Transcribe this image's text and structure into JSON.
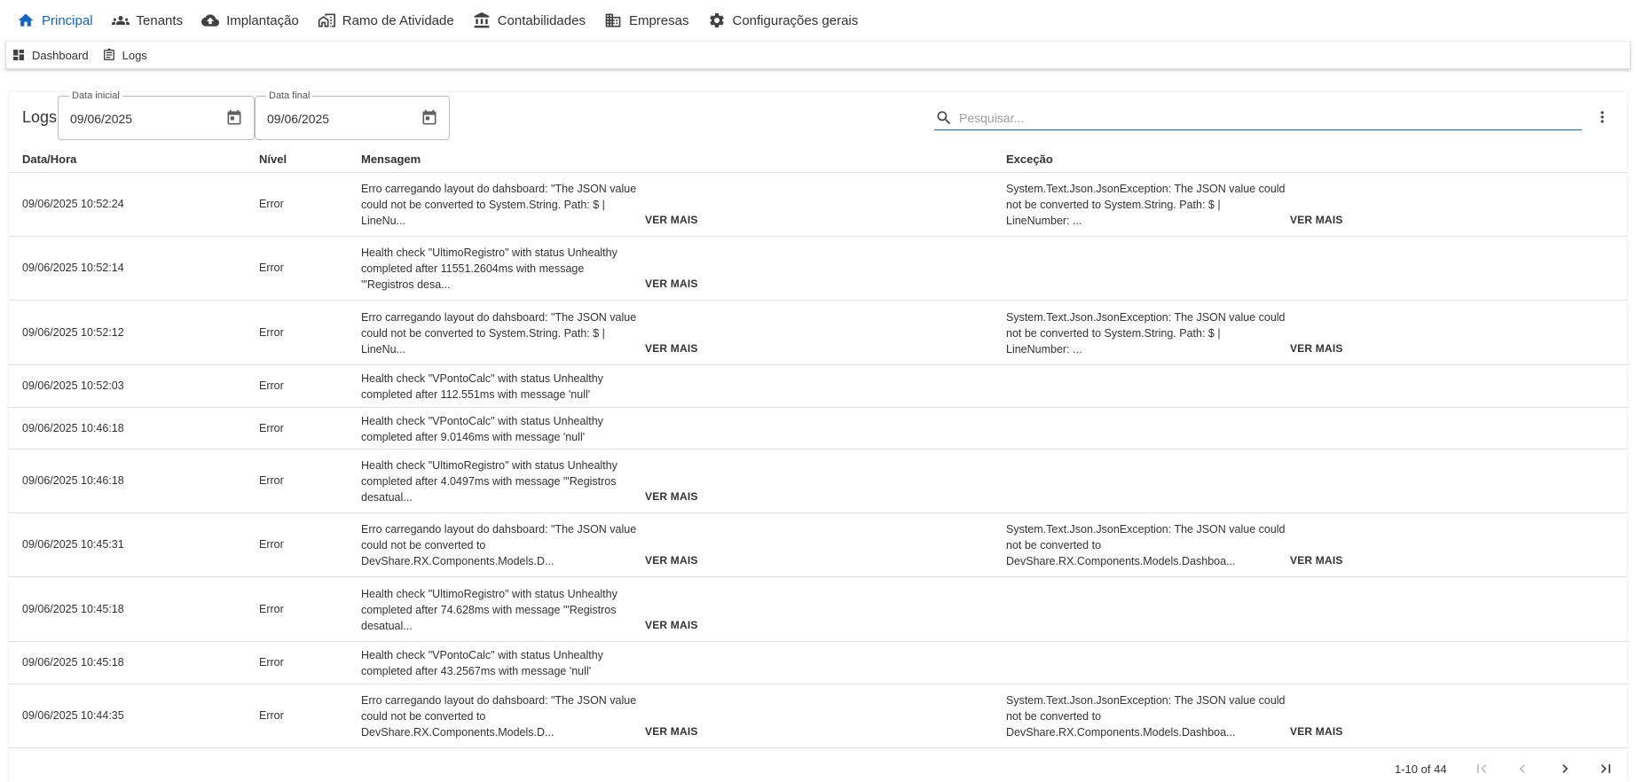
{
  "topnav": {
    "items": [
      {
        "label": "Principal",
        "icon": "home-icon",
        "active": true
      },
      {
        "label": "Tenants",
        "icon": "groups-icon"
      },
      {
        "label": "Implantação",
        "icon": "cloud-upload-icon"
      },
      {
        "label": "Ramo de Atividade",
        "icon": "store-icon"
      },
      {
        "label": "Contabilidades",
        "icon": "bank-icon"
      },
      {
        "label": "Empresas",
        "icon": "building-icon"
      },
      {
        "label": "Configurações gerais",
        "icon": "gear-icon"
      }
    ]
  },
  "subnav": {
    "items": [
      {
        "label": "Dashboard",
        "icon": "dashboard-icon"
      },
      {
        "label": "Logs",
        "icon": "list-icon"
      }
    ]
  },
  "page": {
    "title": "Logs",
    "date_start": {
      "label": "Data inicial",
      "value": "09/06/2025"
    },
    "date_end": {
      "label": "Data final",
      "value": "09/06/2025"
    },
    "search_placeholder": "Pesquisar..."
  },
  "table": {
    "headers": {
      "date": "Data/Hora",
      "level": "Nível",
      "message": "Mensagem",
      "exception": "Exceção"
    },
    "more_label": "VER MAIS",
    "rows": [
      {
        "date": "09/06/2025 10:52:24",
        "level": "Error",
        "message": [
          "Erro carregando layout do dahsboard: \"The JSON value",
          "could not be converted to System.String. Path: $ |",
          "LineNu..."
        ],
        "message_more": true,
        "exception": [
          "System.Text.Json.JsonException: The JSON value could",
          "not be converted to System.String. Path: $ |",
          "LineNumber: ..."
        ],
        "exception_more": true
      },
      {
        "date": "09/06/2025 10:52:14",
        "level": "Error",
        "message": [
          "Health check \"UltimoRegistro\" with status Unhealthy",
          "completed after 11551.2604ms with message",
          "'\"Registros desa..."
        ],
        "message_more": true,
        "exception": [],
        "exception_more": false
      },
      {
        "date": "09/06/2025 10:52:12",
        "level": "Error",
        "message": [
          "Erro carregando layout do dahsboard: \"The JSON value",
          "could not be converted to System.String. Path: $ |",
          "LineNu..."
        ],
        "message_more": true,
        "exception": [
          "System.Text.Json.JsonException: The JSON value could",
          "not be converted to System.String. Path: $ |",
          "LineNumber: ..."
        ],
        "exception_more": true
      },
      {
        "date": "09/06/2025 10:52:03",
        "level": "Error",
        "message": [
          "Health check \"VPontoCalc\" with status Unhealthy",
          "completed after 112.551ms with message 'null'"
        ],
        "message_more": false,
        "exception": [],
        "exception_more": false
      },
      {
        "date": "09/06/2025 10:46:18",
        "level": "Error",
        "message": [
          "Health check \"VPontoCalc\" with status Unhealthy",
          "completed after 9.0146ms with message 'null'"
        ],
        "message_more": false,
        "exception": [],
        "exception_more": false
      },
      {
        "date": "09/06/2025 10:46:18",
        "level": "Error",
        "message": [
          "Health check \"UltimoRegistro\" with status Unhealthy",
          "completed after 4.0497ms with message '\"Registros",
          "desatual..."
        ],
        "message_more": true,
        "exception": [],
        "exception_more": false
      },
      {
        "date": "09/06/2025 10:45:31",
        "level": "Error",
        "message": [
          "Erro carregando layout do dahsboard: \"The JSON value",
          "could not be converted to",
          "DevShare.RX.Components.Models.D..."
        ],
        "message_more": true,
        "exception": [
          "System.Text.Json.JsonException: The JSON value could",
          "not be converted to",
          "DevShare.RX.Components.Models.Dashboa..."
        ],
        "exception_more": true
      },
      {
        "date": "09/06/2025 10:45:18",
        "level": "Error",
        "message": [
          "Health check \"UltimoRegistro\" with status Unhealthy",
          "completed after 74.628ms with message '\"Registros",
          "desatual..."
        ],
        "message_more": true,
        "exception": [],
        "exception_more": false
      },
      {
        "date": "09/06/2025 10:45:18",
        "level": "Error",
        "message": [
          "Health check \"VPontoCalc\" with status Unhealthy",
          "completed after 43.2567ms with message 'null'"
        ],
        "message_more": false,
        "exception": [],
        "exception_more": false
      },
      {
        "date": "09/06/2025 10:44:35",
        "level": "Error",
        "message": [
          "Erro carregando layout do dahsboard: \"The JSON value",
          "could not be converted to",
          "DevShare.RX.Components.Models.D..."
        ],
        "message_more": true,
        "exception": [
          "System.Text.Json.JsonException: The JSON value could",
          "not be converted to",
          "DevShare.RX.Components.Models.Dashboa..."
        ],
        "exception_more": true
      }
    ]
  },
  "pagination": {
    "range_text": "1-10 of 44",
    "buttons": [
      {
        "icon": "first-page-icon",
        "enabled": false
      },
      {
        "icon": "previous-page-icon",
        "enabled": false
      },
      {
        "icon": "next-page-icon",
        "enabled": true
      },
      {
        "icon": "last-page-icon",
        "enabled": true
      }
    ]
  },
  "colors": {
    "accent": "#1565c0",
    "text": "#333333",
    "border": "#e0e0e0",
    "disabled": "#bdbdbd"
  }
}
